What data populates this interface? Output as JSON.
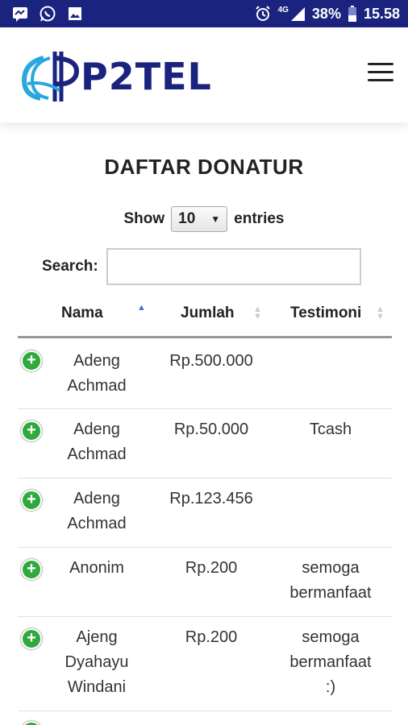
{
  "status_bar": {
    "network": "4G",
    "battery": "38%",
    "time": "15.58"
  },
  "header": {
    "logo_text": "P2TEL"
  },
  "main": {
    "title": "DAFTAR DONATUR",
    "show_label": "Show",
    "entries_value": "10",
    "entries_label": "entries",
    "search_label": "Search:",
    "search_value": ""
  },
  "table": {
    "columns": [
      "Nama",
      "Jumlah",
      "Testimoni"
    ],
    "rows": [
      {
        "nama": [
          "Adeng",
          "Achmad"
        ],
        "jumlah": "Rp.500.000",
        "testimoni": []
      },
      {
        "nama": [
          "Adeng",
          "Achmad"
        ],
        "jumlah": "Rp.50.000",
        "testimoni": [
          "Tcash"
        ]
      },
      {
        "nama": [
          "Adeng",
          "Achmad"
        ],
        "jumlah": "Rp.123.456",
        "testimoni": []
      },
      {
        "nama": [
          "Anonim"
        ],
        "jumlah": "Rp.200",
        "testimoni": [
          "semoga",
          "bermanfaat"
        ]
      },
      {
        "nama": [
          "Ajeng",
          "Dyahayu",
          "Windani"
        ],
        "jumlah": "Rp.200",
        "testimoni": [
          "semoga",
          "bermanfaat",
          ":)"
        ]
      }
    ]
  },
  "colors": {
    "status_bar": "#1a237e",
    "brand": "#1a237e",
    "expand_button": "#2eaa3c"
  }
}
